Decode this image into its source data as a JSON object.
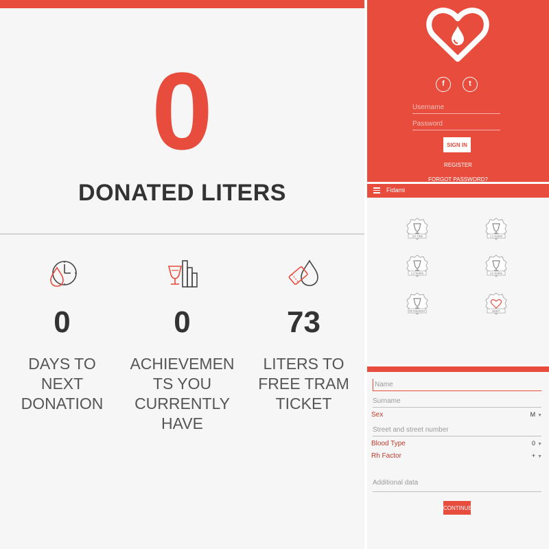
{
  "theme": {
    "accent": "#e84c3d",
    "text_dark": "#333333",
    "background": "#f6f6f6"
  },
  "summary": {
    "donated_liters_value": "0",
    "donated_liters_label": "DONATED LITERS"
  },
  "stats": [
    {
      "icon": "clock-drop-icon",
      "value": "0",
      "label": "DAYS TO NEXT DONATION"
    },
    {
      "icon": "trophy-bars-icon",
      "value": "0",
      "label": "ACHIEVEMEN TS YOU CURRENTLY HAVE"
    },
    {
      "icon": "ticket-drop-icon",
      "value": "73",
      "label": "LITERS TO FREE TRAM TICKET"
    }
  ],
  "login": {
    "logo_icon": "heart-drop-logo-icon",
    "social": {
      "facebook": "f",
      "twitter": "t"
    },
    "username_placeholder": "Username",
    "password_placeholder": "Password",
    "signin_label": "SIGN IN",
    "register_label": "REGISTER",
    "forgot_label": "FORGOT PASSWORD?"
  },
  "achievements": {
    "app_title": "Fidami",
    "menu_icon": "hamburger-menu-icon",
    "badges": [
      {
        "icon": "trophy-badge-icon",
        "label": "1ST TIME"
      },
      {
        "icon": "trophy-badge-icon",
        "label": "1-2 YEARS"
      },
      {
        "icon": "trophy-badge-icon",
        "label": "2-3 YEARS"
      },
      {
        "icon": "trophy-badge-icon",
        "label": "3-5 YEARS"
      },
      {
        "icon": "trophy-badge-icon",
        "label": "RETIREMENT"
      },
      {
        "icon": "heart-badge-icon",
        "label": "HEART"
      }
    ]
  },
  "registration": {
    "name_placeholder": "Name",
    "surname_placeholder": "Surname",
    "sex_label": "Sex",
    "sex_value": "M",
    "street_placeholder": "Street and street number",
    "blood_type_label": "Blood Type",
    "blood_type_value": "0",
    "rh_factor_label": "Rh Factor",
    "rh_factor_value": "+",
    "additional_placeholder": "Additional data",
    "continue_label": "CONTINUE"
  }
}
